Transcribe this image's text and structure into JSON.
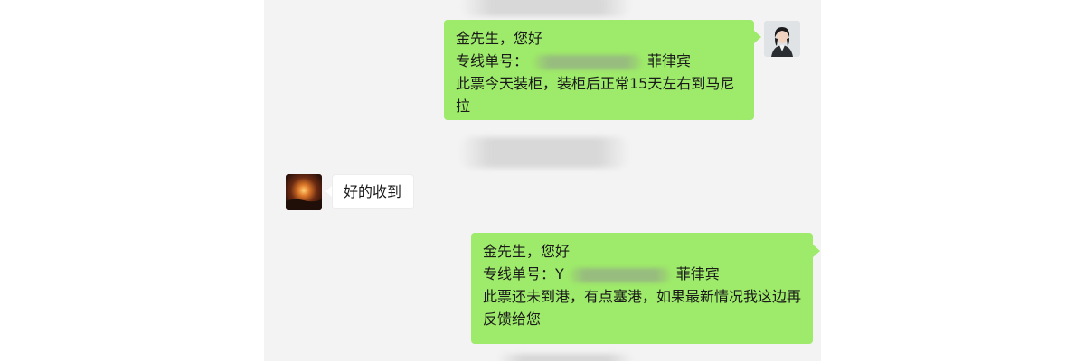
{
  "chat": {
    "messages": [
      {
        "sender": "agent",
        "lines": [
          "金先生，您好",
          "专线单号：",
          "菲律宾",
          "此票今天装柜，装柜后正常15天左右到马尼拉"
        ]
      },
      {
        "sender": "customer",
        "text": "好的收到"
      },
      {
        "sender": "agent",
        "lines": [
          "金先生，您好",
          "专线单号：Y",
          "菲律宾",
          "此票还未到港，有点塞港，如果最新情况我这边再反馈给您"
        ]
      }
    ]
  },
  "colors": {
    "panel_bg": "#f3f3f3",
    "outgoing_bubble": "#9eea6a",
    "incoming_bubble": "#ffffff"
  },
  "icons": {
    "agent_avatar": "woman-portrait-avatar",
    "customer_avatar": "sunset-avatar"
  }
}
